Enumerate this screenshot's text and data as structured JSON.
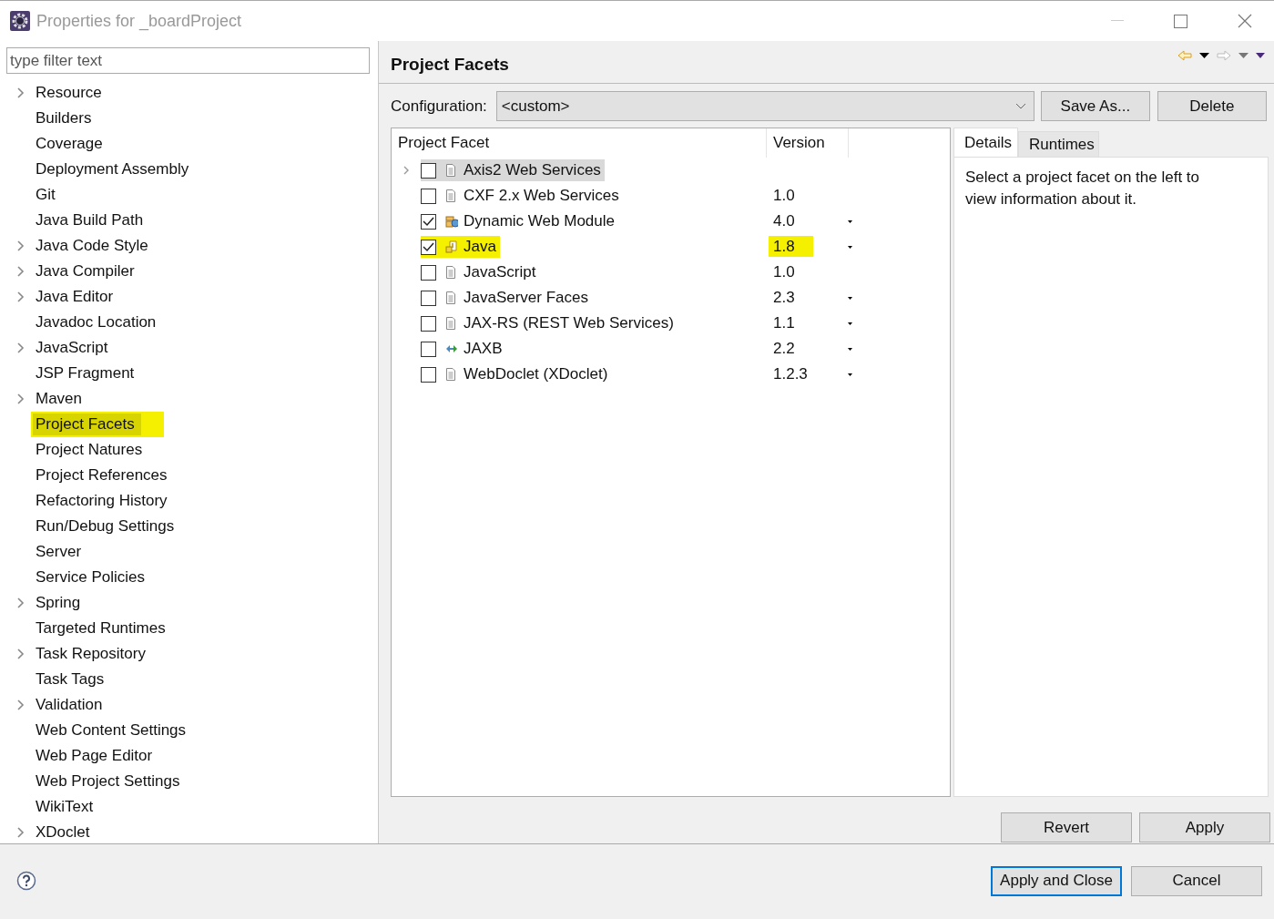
{
  "window": {
    "title": "Properties for _boardProject"
  },
  "filter": {
    "placeholder": "type filter text"
  },
  "tree": [
    {
      "label": "Resource",
      "expandable": true,
      "selected": false,
      "highlighted": false
    },
    {
      "label": "Builders",
      "expandable": false,
      "selected": false,
      "highlighted": false
    },
    {
      "label": "Coverage",
      "expandable": false,
      "selected": false,
      "highlighted": false
    },
    {
      "label": "Deployment Assembly",
      "expandable": false,
      "selected": false,
      "highlighted": false
    },
    {
      "label": "Git",
      "expandable": false,
      "selected": false,
      "highlighted": false
    },
    {
      "label": "Java Build Path",
      "expandable": false,
      "selected": false,
      "highlighted": false
    },
    {
      "label": "Java Code Style",
      "expandable": true,
      "selected": false,
      "highlighted": false
    },
    {
      "label": "Java Compiler",
      "expandable": true,
      "selected": false,
      "highlighted": false
    },
    {
      "label": "Java Editor",
      "expandable": true,
      "selected": false,
      "highlighted": false
    },
    {
      "label": "Javadoc Location",
      "expandable": false,
      "selected": false,
      "highlighted": false
    },
    {
      "label": "JavaScript",
      "expandable": true,
      "selected": false,
      "highlighted": false
    },
    {
      "label": "JSP Fragment",
      "expandable": false,
      "selected": false,
      "highlighted": false
    },
    {
      "label": "Maven",
      "expandable": true,
      "selected": false,
      "highlighted": false
    },
    {
      "label": "Project Facets",
      "expandable": false,
      "selected": true,
      "highlighted": true
    },
    {
      "label": "Project Natures",
      "expandable": false,
      "selected": false,
      "highlighted": false
    },
    {
      "label": "Project References",
      "expandable": false,
      "selected": false,
      "highlighted": false
    },
    {
      "label": "Refactoring History",
      "expandable": false,
      "selected": false,
      "highlighted": false
    },
    {
      "label": "Run/Debug Settings",
      "expandable": false,
      "selected": false,
      "highlighted": false
    },
    {
      "label": "Server",
      "expandable": false,
      "selected": false,
      "highlighted": false
    },
    {
      "label": "Service Policies",
      "expandable": false,
      "selected": false,
      "highlighted": false
    },
    {
      "label": "Spring",
      "expandable": true,
      "selected": false,
      "highlighted": false
    },
    {
      "label": "Targeted Runtimes",
      "expandable": false,
      "selected": false,
      "highlighted": false
    },
    {
      "label": "Task Repository",
      "expandable": true,
      "selected": false,
      "highlighted": false
    },
    {
      "label": "Task Tags",
      "expandable": false,
      "selected": false,
      "highlighted": false
    },
    {
      "label": "Validation",
      "expandable": true,
      "selected": false,
      "highlighted": false
    },
    {
      "label": "Web Content Settings",
      "expandable": false,
      "selected": false,
      "highlighted": false
    },
    {
      "label": "Web Page Editor",
      "expandable": false,
      "selected": false,
      "highlighted": false
    },
    {
      "label": "Web Project Settings",
      "expandable": false,
      "selected": false,
      "highlighted": false
    },
    {
      "label": "WikiText",
      "expandable": false,
      "selected": false,
      "highlighted": false
    },
    {
      "label": "XDoclet",
      "expandable": true,
      "selected": false,
      "highlighted": false
    }
  ],
  "page": {
    "title": "Project Facets"
  },
  "configuration": {
    "label": "Configuration:",
    "value": "<custom>"
  },
  "config_buttons": [
    {
      "label": "Save As..."
    },
    {
      "label": "Delete"
    }
  ],
  "facet_columns": [
    "Project Facet",
    "Version"
  ],
  "facets": [
    {
      "name": "Axis2 Web Services",
      "kind": "document",
      "checked": false,
      "selected": true,
      "expandable": true,
      "dropdown": false,
      "highlighted": false
    },
    {
      "name": "CXF 2.x Web Services",
      "version": "1.0",
      "kind": "document",
      "checked": false,
      "selected": false,
      "expandable": false,
      "dropdown": false,
      "highlighted": false
    },
    {
      "name": "Dynamic Web Module",
      "version": "4.0",
      "kind": "web",
      "checked": true,
      "selected": false,
      "expandable": false,
      "dropdown": true,
      "highlighted": false
    },
    {
      "name": "Java",
      "version": "1.8",
      "kind": "java",
      "checked": true,
      "selected": false,
      "expandable": false,
      "dropdown": true,
      "highlighted": true
    },
    {
      "name": "JavaScript",
      "version": "1.0",
      "kind": "document",
      "checked": false,
      "selected": false,
      "expandable": false,
      "dropdown": false,
      "highlighted": false
    },
    {
      "name": "JavaServer Faces",
      "version": "2.3",
      "kind": "document",
      "checked": false,
      "selected": false,
      "expandable": false,
      "dropdown": true,
      "highlighted": false
    },
    {
      "name": "JAX-RS (REST Web Services)",
      "version": "1.1",
      "kind": "document",
      "checked": false,
      "selected": false,
      "expandable": false,
      "dropdown": true,
      "highlighted": false
    },
    {
      "name": "JAXB",
      "version": "2.2",
      "kind": "arrows",
      "checked": false,
      "selected": false,
      "expandable": false,
      "dropdown": true,
      "highlighted": false
    },
    {
      "name": "WebDoclet (XDoclet)",
      "version": "1.2.3",
      "kind": "document",
      "checked": false,
      "selected": false,
      "expandable": false,
      "dropdown": true,
      "highlighted": false
    }
  ],
  "detail_tabs": [
    {
      "label": "Details",
      "selected": true
    },
    {
      "label": "Runtimes",
      "selected": false
    }
  ],
  "details_text": "Select a project facet on the left to view information about it.",
  "page_buttons": [
    {
      "label": "Revert"
    },
    {
      "label": "Apply"
    }
  ],
  "dialog_buttons": [
    {
      "label": "Apply and Close",
      "default": true
    },
    {
      "label": "Cancel",
      "default": false
    }
  ]
}
